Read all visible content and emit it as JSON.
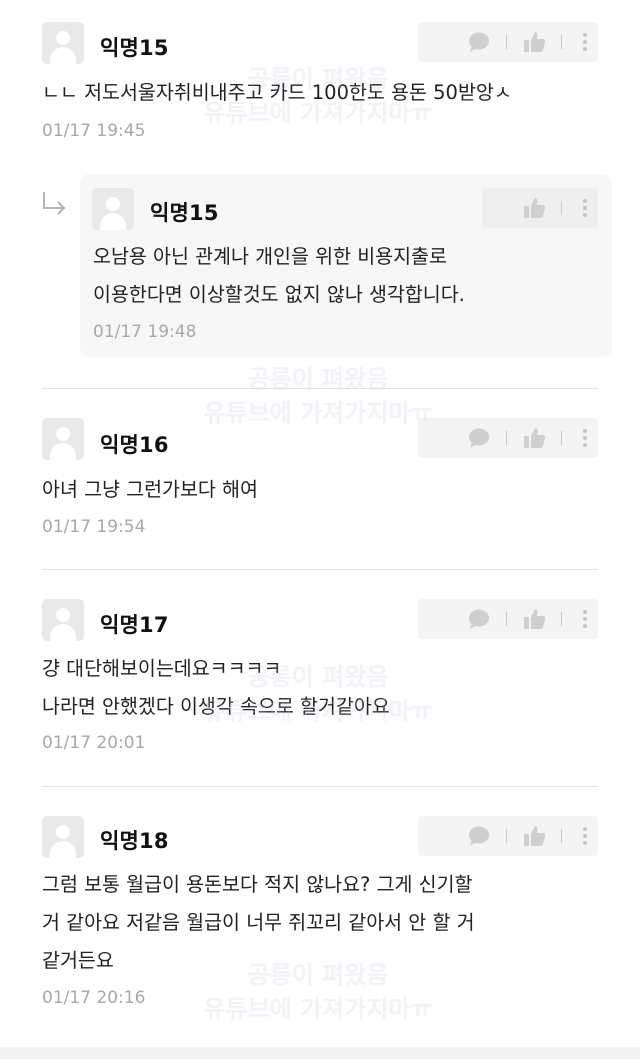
{
  "icons": {
    "avatar": "default-user-avatar",
    "comment": "speech-bubble-icon",
    "like": "thumbs-up-icon",
    "more": "vertical-ellipsis-icon",
    "reply": "reply-arrow-icon"
  },
  "watermark": {
    "line1": "공롱이 펴왔음",
    "line2": "유튜브에 가져가지마ㅠ"
  },
  "comments": [
    {
      "author": "익명15",
      "lines": [
        "ㄴㄴ 저도서울자취비내주고 카드 100한도 용돈 50받앙ㅅ"
      ],
      "time": "01/17 19:45"
    },
    {
      "author": "익명15",
      "is_reply": true,
      "lines": [
        "오남용 아닌 관계나 개인을 위한 비용지출로",
        "이용한다면 이상할것도 없지 않나 생각합니다."
      ],
      "time": "01/17 19:48"
    },
    {
      "author": "익명16",
      "lines": [
        "아녀 그냥 그런가보다 해여"
      ],
      "time": "01/17 19:54"
    },
    {
      "author": "익명17",
      "lines": [
        "걍 대단해보이는데요ㅋㅋㅋㅋ",
        "나라면 안했겠다 이생각 속으로 할거같아요"
      ],
      "time": "01/17 20:01"
    },
    {
      "author": "익명18",
      "lines": [
        "그럼 보통 월급이 용돈보다 적지 않나요? 그게 신기할",
        "거 같아요 저같음 월급이 너무 쥐꼬리 같아서 안 할 거",
        "같거든요"
      ],
      "time": "01/17 20:16"
    }
  ]
}
